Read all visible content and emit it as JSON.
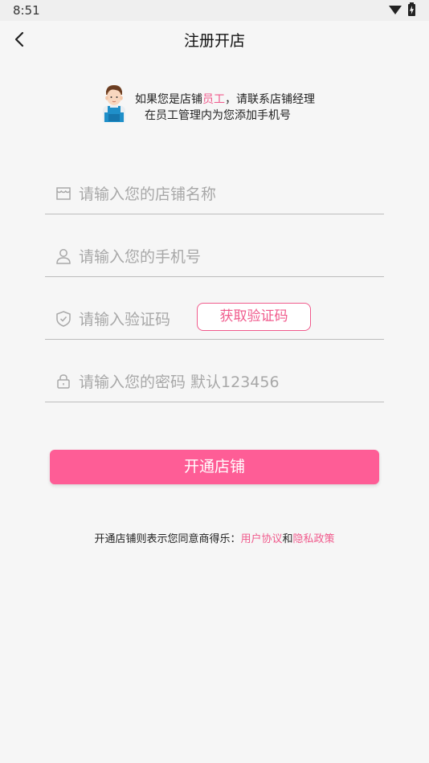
{
  "status_bar": {
    "time": "8:51"
  },
  "header": {
    "title": "注册开店",
    "back_icon": "chevron-left-icon"
  },
  "notice": {
    "prefix": "如果您是店铺",
    "highlight": "员工",
    "suffix": "，请联系店铺经理",
    "line2": "在员工管理内为您添加手机号",
    "icon": "worker-avatar-icon",
    "highlight_color": "#f05a8c"
  },
  "form": {
    "store_name": {
      "placeholder": "请输入您的店铺名称",
      "icon": "store-icon"
    },
    "phone": {
      "placeholder": "请输入您的手机号",
      "icon": "user-icon"
    },
    "code": {
      "placeholder": "请输入验证码",
      "icon": "shield-check-icon",
      "button_label": "获取验证码"
    },
    "password": {
      "placeholder": "请输入您的密码 默认123456",
      "icon": "lock-icon"
    }
  },
  "submit": {
    "label": "开通店铺",
    "color": "#fe5d96"
  },
  "agreement": {
    "prefix": "开通店铺则表示您同意商得乐：",
    "user_agreement": "用户协议",
    "and": "和",
    "privacy_policy": "隐私政策",
    "link_color": "#f05a8c"
  }
}
